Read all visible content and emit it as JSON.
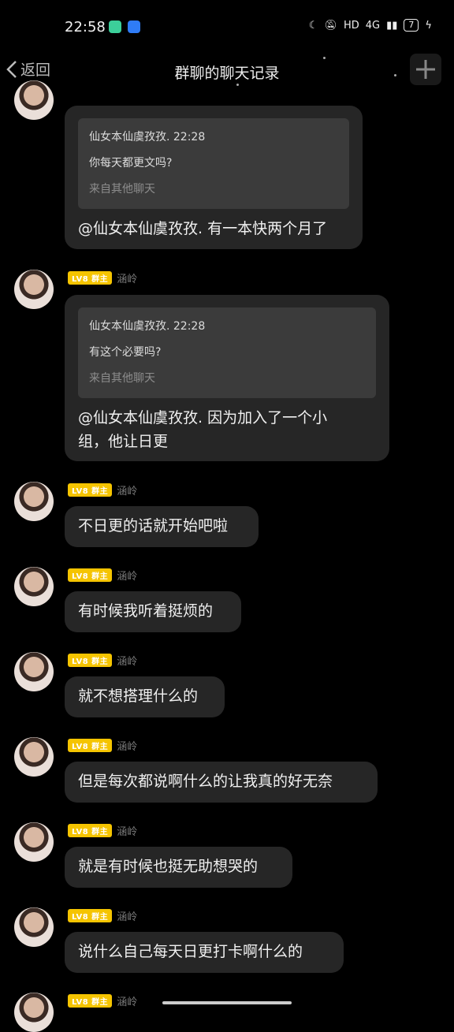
{
  "status_bar": {
    "time": "22:58",
    "network": "4G",
    "hd": "HD",
    "battery": "7"
  },
  "nav": {
    "back_label": "返回",
    "title": "群聊的聊天记录"
  },
  "member": {
    "badge": "LV8 群主",
    "nickname": "涵岭"
  },
  "messages": [
    {
      "quote_line1": "仙女本仙虞孜孜. 22:28",
      "quote_line2": "你每天都更文吗?",
      "quote_source": "来自其他聊天",
      "text": "@仙女本仙虞孜孜. 有一本快两个月了"
    },
    {
      "quote_line1": "仙女本仙虞孜孜. 22:28",
      "quote_line2": "有这个必要吗?",
      "quote_source": "来自其他聊天",
      "text_line1": "@仙女本仙虞孜孜. 因为加入了一个小",
      "text_line2": "组，他让日更"
    },
    {
      "text": "不日更的话就开始吧啦"
    },
    {
      "text": "有时候我听着挺烦的"
    },
    {
      "text": "就不想搭理什么的"
    },
    {
      "text": "但是每次都说啊什么的让我真的好无奈"
    },
    {
      "text": "就是有时候也挺无助想哭的"
    },
    {
      "text": "说什么自己每天日更打卡啊什么的"
    }
  ],
  "colors": {
    "background": "#000000",
    "bubble": "#262626",
    "quote": "#3b3b3b",
    "badge": "#f5c400"
  }
}
